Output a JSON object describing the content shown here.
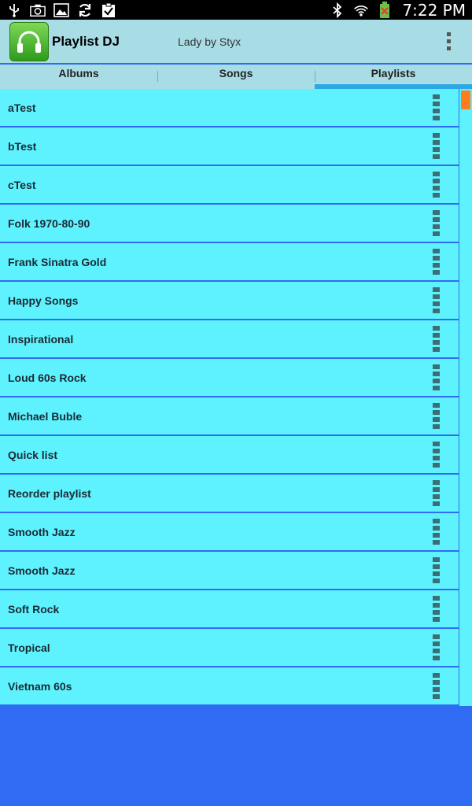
{
  "status_bar": {
    "time": "7:22 PM",
    "left_icons": [
      "usb-icon",
      "camera-icon",
      "image-icon",
      "sync-icon",
      "clipboard-check-icon"
    ],
    "right_icons": [
      "bluetooth-icon",
      "wifi-icon",
      "battery-icon"
    ]
  },
  "app_bar": {
    "title": "Playlist DJ",
    "now_playing": "Lady by Styx",
    "logo_icon": "headphones-icon",
    "menu_icon": "overflow-menu-icon"
  },
  "tabs": [
    {
      "label": "Albums",
      "active": false
    },
    {
      "label": "Songs",
      "active": false
    },
    {
      "label": "Playlists",
      "active": true
    }
  ],
  "playlists": [
    {
      "label": "aTest"
    },
    {
      "label": "bTest"
    },
    {
      "label": "cTest"
    },
    {
      "label": "Folk 1970-80-90"
    },
    {
      "label": "Frank Sinatra Gold"
    },
    {
      "label": "Happy Songs"
    },
    {
      "label": "Inspirational"
    },
    {
      "label": "Loud 60s Rock"
    },
    {
      "label": "Michael Buble"
    },
    {
      "label": "Quick list"
    },
    {
      "label": "Reorder playlist"
    },
    {
      "label": "Smooth Jazz"
    },
    {
      "label": "Smooth Jazz"
    },
    {
      "label": "Soft Rock"
    },
    {
      "label": "Tropical"
    },
    {
      "label": "Vietnam 60s"
    }
  ],
  "colors": {
    "background": "#2f6cf3",
    "list_item": "#5ef2ff",
    "app_bar": "#a9dde6",
    "tab_indicator": "#2ba7e6",
    "scroll_thumb": "#ff7d1c"
  }
}
